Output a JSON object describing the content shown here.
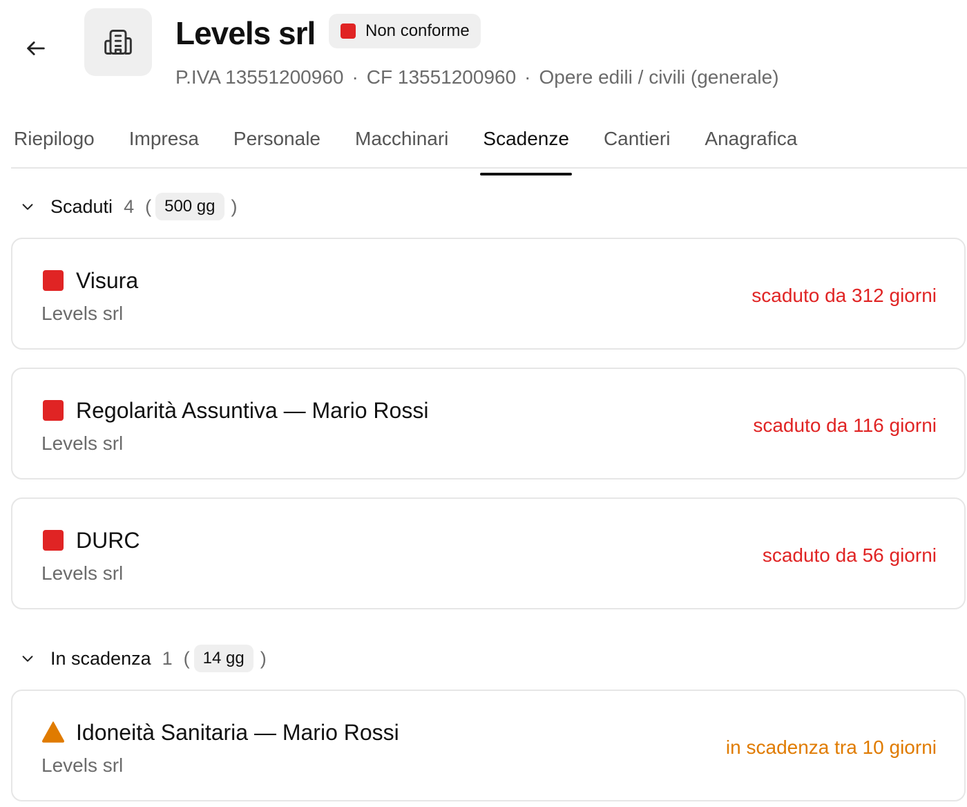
{
  "header": {
    "company_name": "Levels srl",
    "status_label": "Non conforme",
    "status_color": "#e02424",
    "meta": {
      "piva": "P.IVA 13551200960",
      "cf": "CF 13551200960",
      "category": "Opere edili / civili (generale)",
      "separator": "·"
    },
    "icons": {
      "back": "arrow-left-icon",
      "logo": "building-icon"
    }
  },
  "tabs": [
    {
      "label": "Riepilogo",
      "active": false
    },
    {
      "label": "Impresa",
      "active": false
    },
    {
      "label": "Personale",
      "active": false
    },
    {
      "label": "Macchinari",
      "active": false
    },
    {
      "label": "Scadenze",
      "active": true
    },
    {
      "label": "Cantieri",
      "active": false
    },
    {
      "label": "Anagrafica",
      "active": false
    }
  ],
  "sections": [
    {
      "title": "Scaduti",
      "count": "4",
      "paren_open": "(",
      "chip": "500 gg",
      "paren_close": ")",
      "items": [
        {
          "title": "Visura",
          "subtitle": "Levels srl",
          "status": "scaduto da 312 giorni",
          "icon": "red-square-icon"
        },
        {
          "title": "Regolarità Assuntiva — Mario Rossi",
          "subtitle": "Levels srl",
          "status": "scaduto da 116 giorni",
          "icon": "red-square-icon"
        },
        {
          "title": "DURC",
          "subtitle": "Levels srl",
          "status": "scaduto da 56 giorni",
          "icon": "red-square-icon"
        }
      ]
    },
    {
      "title": "In scadenza",
      "count": "1",
      "paren_open": "(",
      "chip": "14 gg",
      "paren_close": ")",
      "items": [
        {
          "title": "Idoneità Sanitaria — Mario Rossi",
          "subtitle": "Levels srl",
          "status": "in scadenza tra 10 giorni",
          "icon": "warning-triangle-icon"
        }
      ]
    }
  ],
  "colors": {
    "expired": "#e02424",
    "expiring": "#e07b00",
    "muted": "#6b6b6b",
    "chip_bg": "#efefef"
  }
}
